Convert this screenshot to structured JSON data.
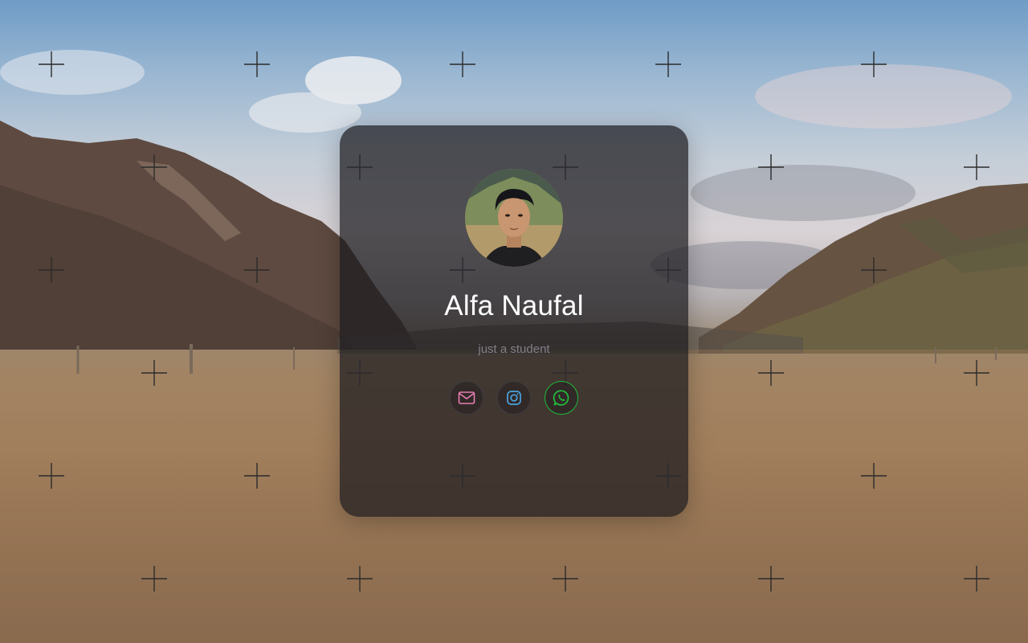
{
  "profile": {
    "name": "Alfa Naufal",
    "tagline": "just a student"
  },
  "socials": [
    {
      "icon": "mail-icon",
      "color": "#e57fb3"
    },
    {
      "icon": "instagram-icon",
      "color": "#4aa3e0"
    },
    {
      "icon": "whatsapp-icon",
      "color": "#22c03c"
    }
  ],
  "colors": {
    "card_background": "#1c1a1e",
    "name_text": "#ffffff",
    "tagline_text": "#7f7f85",
    "cross_marks": "#2b2b2b"
  }
}
